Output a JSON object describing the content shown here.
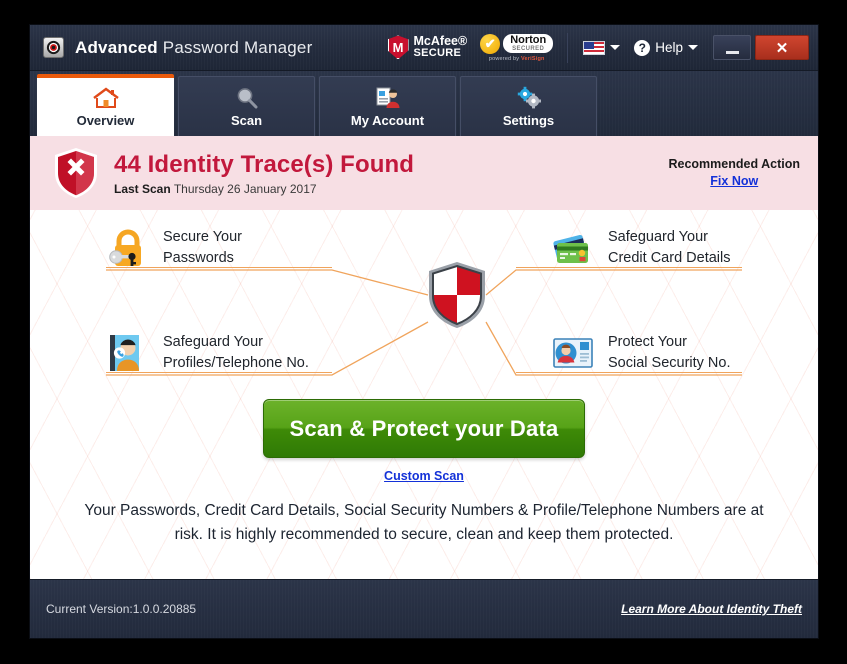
{
  "window": {
    "title_bold": "Advanced",
    "title_rest": " Password Manager",
    "app_icon": "target-bullseye-icon"
  },
  "titlebar": {
    "mcafee_badge": {
      "line1": "McAfee®",
      "line2": "SECURE",
      "mark": "M"
    },
    "norton_badge": {
      "line1": "Norton",
      "line2": "SECURED",
      "sub_prefix": "powered by ",
      "sub_brand": "VeriSign",
      "mark": "✔"
    },
    "language_flag": "us-flag-icon",
    "help_label": "Help",
    "help_icon": "question-mark-icon",
    "minimize_label": "–",
    "close_label": "✕"
  },
  "tabs": [
    {
      "label": "Overview",
      "icon": "house-icon",
      "active": true
    },
    {
      "label": "Scan",
      "icon": "magnifier-icon",
      "active": false
    },
    {
      "label": "My Account",
      "icon": "user-document-icon",
      "active": false
    },
    {
      "label": "Settings",
      "icon": "gears-icon",
      "active": false
    }
  ],
  "alert": {
    "icon": "red-shield-x-icon",
    "title": "44 Identity Trace(s) Found",
    "last_scan_label": "Last Scan",
    "last_scan_value": " Thursday 26 January 2017",
    "recommended_action_label": "Recommended Action",
    "fix_now_label": "Fix Now",
    "bg_color": "#f7dfe4",
    "title_color": "#c2183c",
    "link_color": "#1331d8"
  },
  "features": [
    {
      "id": "passwords",
      "icon": "padlock-key-icon",
      "line1": "Secure Your",
      "line2": "Passwords"
    },
    {
      "id": "credit-cards",
      "icon": "credit-cards-icon",
      "line1": "Safeguard Your",
      "line2": "Credit Card Details"
    },
    {
      "id": "profiles",
      "icon": "person-phonebook-icon",
      "line1": "Safeguard Your",
      "line2": "Profiles/Telephone No."
    },
    {
      "id": "social-security",
      "icon": "id-card-icon",
      "line1": "Protect Your",
      "line2": "Social Security No."
    }
  ],
  "center": {
    "icon": "checkered-shield-icon",
    "connector_color": "#f0a45c"
  },
  "cta": {
    "scan_button_label": "Scan & Protect your Data",
    "custom_scan_label": "Custom Scan",
    "button_color": "#4e9a12"
  },
  "description": "Your Passwords, Credit Card Details, Social Security Numbers & Profile/Telephone Numbers are at risk. It is highly recommended to secure, clean and keep them protected.",
  "footer": {
    "version_text": "Current Version:1.0.0.20885",
    "learn_more_label": "Learn More About Identity Theft"
  }
}
